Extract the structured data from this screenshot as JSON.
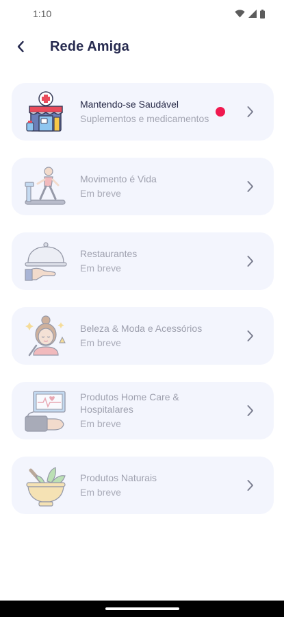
{
  "status_bar": {
    "time": "1:10",
    "icons": [
      "wifi-icon",
      "signal-icon",
      "battery-icon"
    ]
  },
  "header": {
    "title": "Rede Amiga",
    "back_icon": "chevron-left-icon"
  },
  "items": [
    {
      "title": "Mantendo-se Saudável",
      "subtitle": "Suplementos e medicamentos",
      "icon": "pharmacy-store-icon",
      "active": true,
      "has_notification": true
    },
    {
      "title": "Movimento é Vida",
      "subtitle": "Em breve",
      "icon": "treadmill-runner-icon",
      "active": false
    },
    {
      "title": "Restaurantes",
      "subtitle": "Em breve",
      "icon": "food-cloche-icon",
      "active": false
    },
    {
      "title": "Beleza & Moda e Acessórios",
      "subtitle": "Em breve",
      "icon": "beauty-makeup-icon",
      "active": false
    },
    {
      "title": "Produtos Home Care & Hospitalares",
      "subtitle": "Em breve",
      "icon": "medical-monitor-icon",
      "active": false
    },
    {
      "title": "Produtos Naturais",
      "subtitle": "Em breve",
      "icon": "mortar-herbs-icon",
      "active": false
    }
  ],
  "colors": {
    "title": "#262a4f",
    "card_background": "#f3f5fd",
    "notification": "#f0194f",
    "muted_text": "#9ea0ae"
  }
}
